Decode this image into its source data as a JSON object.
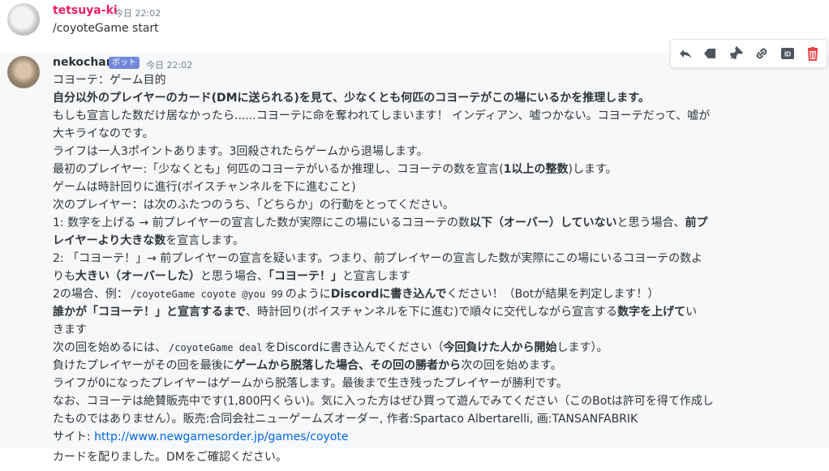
{
  "msg1": {
    "username": "tetsuya-ki",
    "username_color": "#e91e63",
    "timestamp": "今日 22:02",
    "text": "/coyoteGame start"
  },
  "msg2": {
    "username": "nekochan",
    "bot_badge": "ボット",
    "timestamp": "今日 22:02",
    "lines": {
      "l1": "コヨーテ：ゲーム目的",
      "l2": "自分以外のプレイヤーのカード(DMに送られる)を見て、少なくとも何匹のコヨーテがこの場にいるかを推理します。",
      "l3": "もしも宣言した数だけ居なかったら......コヨーテに命を奪われてしまいます！ インディアン、嘘つかない。コヨーテだって、嘘が",
      "l4": "大キライなのです。",
      "l5": "ライフは一人3ポイントあります。3回殺されたらゲームから退場します。",
      "l6a": "最初のプレイヤー:「少なくとも」何匹のコヨーテがいるか推理し、コヨーテの数を宣言(",
      "l6b": "1以上の整数",
      "l6c": ")します。",
      "l7": "ゲームは時計回りに進行(ボイスチャンネルを下に進むこと)",
      "l8": "次のプレイヤー：は次のふたつのうち、「どちらか」の行動をとってください。",
      "l9a": "1: 数字を上げる → 前プレイヤーの宣言した数が実際にこの場にいるコヨーテの数",
      "l9b": "以下（オーバー）していない",
      "l9c": "と思う場合、",
      "l9d": "前プ",
      "l10a": "レイヤーより大きな数",
      "l10b": "を宣言します。",
      "l11": "2: 「コヨーテ！」→ 前プレイヤーの宣言を疑います。つまり、前プレイヤーの宣言した数が実際にこの場にいるコヨーテの数よ",
      "l12a": "りも",
      "l12b": "大きい（オーバーした）",
      "l12c": "と思う場合、",
      "l12d": "「コヨーテ！」",
      "l12e": "と宣言します",
      "l13a": "2の場合、例：",
      "l13code": "/coyoteGame coyote @you 99",
      "l13b": "のように",
      "l13c": "Discordに書き込んで",
      "l13d": "ください！（Botが結果を判定します！）",
      "l14a": "誰かが「コヨーテ！」と宣言するまで",
      "l14b": "、時計回り(ボイスチャンネルを下に進む)で順々に交代しながら宣言する",
      "l14c": "数字を上げて",
      "l14d": "い",
      "l15": "きます",
      "l16a": "次の回を始めるには、",
      "l16code": "/coyoteGame deal",
      "l16b": "をDiscordに書き込んでください（",
      "l16c": "今回負けた人から開始",
      "l16d": "します）。",
      "l17a": "負けたプレイヤーがその回を最後に",
      "l17b": "ゲームから脱落した場合、その回の勝者から",
      "l17c": "次の回を始めます。",
      "l18": "ライフが0になったプレイヤーはゲームから脱落します。最後まで生き残ったプレイヤーが勝利です。",
      "l19": "なお、コヨーテは絶賛販売中です(1,800円くらい)。気に入った方はぜひ買って遊んでみてください（このBotは許可を得て作成し",
      "l20": "たものではありません）。販売:合同会社ニューゲームズオーダー, 作者:Spartaco Albertarelli, 画:TANSANFABRIK",
      "l21a": "サイト: ",
      "l21link": "http://www.newgamesorder.jp/games/coyote"
    },
    "followup": "カードを配りました。DMをご確認ください。"
  },
  "toolbar": {
    "icons": [
      "reply-icon",
      "tag-icon",
      "pin-icon",
      "link-icon",
      "id-icon",
      "delete-icon"
    ],
    "delete_color": "#ed4245"
  }
}
